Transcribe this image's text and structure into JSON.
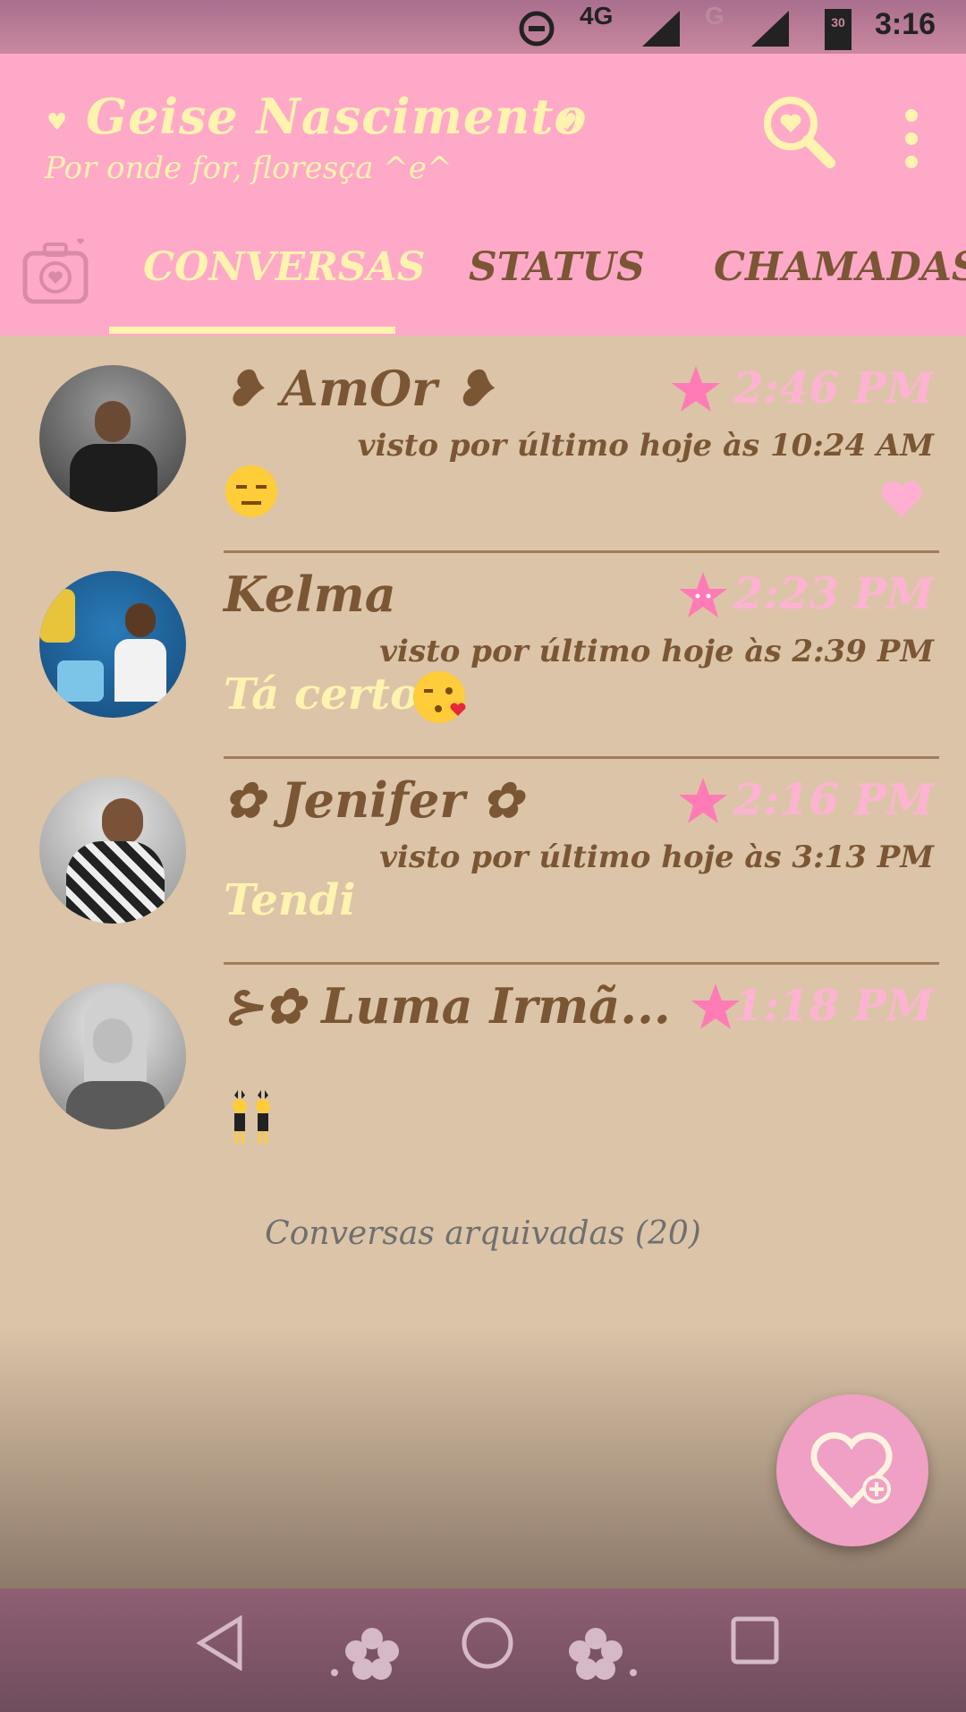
{
  "status_bar": {
    "network_4g": "4G",
    "network_g": "G",
    "battery": "30",
    "time": "3:16"
  },
  "app_bar": {
    "title": "Geise Nascimento",
    "subtitle": "Por onde for, floresça ^e^",
    "title_color": "#fff3b0",
    "background": "#ffa9c8"
  },
  "tabs": [
    {
      "label": "CONVERSAS",
      "selected": true
    },
    {
      "label": "STATUS",
      "selected": false
    },
    {
      "label": "CHAMADAS",
      "selected": false
    }
  ],
  "chats": [
    {
      "name": "❥ AmOr ❥",
      "time": "2:46 PM",
      "seen": "visto por último hoje às 10:24 AM",
      "message": "",
      "emoji": "expressionless-face-emoji",
      "pinned_heart": true
    },
    {
      "name": "Kelma",
      "time": "2:23 PM",
      "seen": "visto por último hoje às 2:39 PM",
      "message": "Tá certo",
      "emoji": "kissing-face-emoji",
      "pinned_heart": false
    },
    {
      "name": "✿ Jenifer ✿",
      "time": "2:16 PM",
      "seen": "visto por último hoje às 3:13 PM",
      "message": "Tendi",
      "emoji": "",
      "pinned_heart": false
    },
    {
      "name": "⊱✿ Luma Irmã...",
      "time": "1:18 PM",
      "seen": "",
      "message": "",
      "emoji": "dancing-women-emoji",
      "pinned_heart": false
    }
  ],
  "archived": "Conversas arquivadas (20)",
  "colors": {
    "list_background": "#dcc4a8",
    "name_color": "#7a5634",
    "time_color": "#ffb3d3",
    "message_color": "#fff3b0",
    "fab": "#f0a0c4"
  }
}
